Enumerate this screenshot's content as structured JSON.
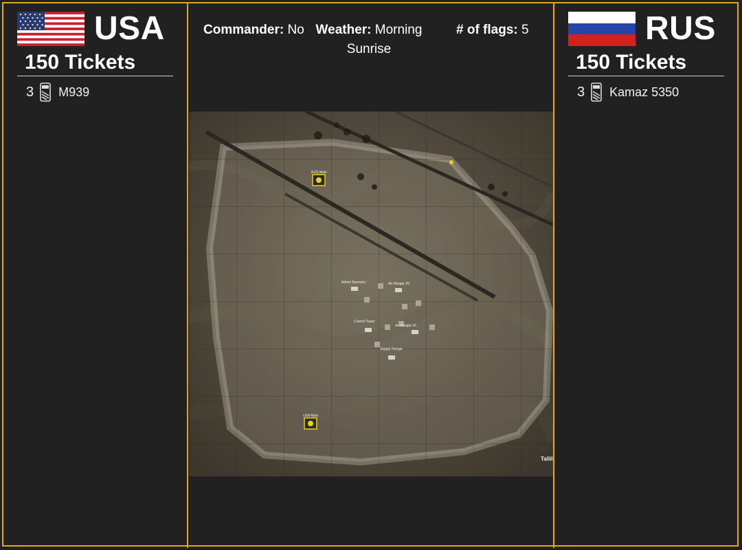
{
  "teams": {
    "left": {
      "name": "USA",
      "tickets": "150 Tickets",
      "vehicles": [
        {
          "count": "3",
          "name": "M939",
          "icon": "truck-icon"
        }
      ]
    },
    "right": {
      "name": "RUS",
      "tickets": "150 Tickets",
      "vehicles": [
        {
          "count": "3",
          "name": "Kamaz 5350",
          "icon": "truck-icon"
        }
      ]
    }
  },
  "info": {
    "commander_label": "Commander:",
    "commander_value": "No",
    "weather_label": "Weather:",
    "weather_value": "Morning Sunrise",
    "flags_label": "# of flags:",
    "flags_value": "5"
  },
  "map": {
    "labels": {
      "rus_main": "RUS Main",
      "usa_main": "USA Main",
      "admin_barracks": "Admin Barracks",
      "air_hangar_5": "Air Hangar #5",
      "control_tower": "Control Tower",
      "air_hangar_2": "Air Hangar #2",
      "supply_hangar": "Supply Hangar",
      "tallil": "Tallil"
    }
  },
  "colors": {
    "accent": "#e3a81a",
    "background": "#212121",
    "marker": "#e8d21a"
  }
}
